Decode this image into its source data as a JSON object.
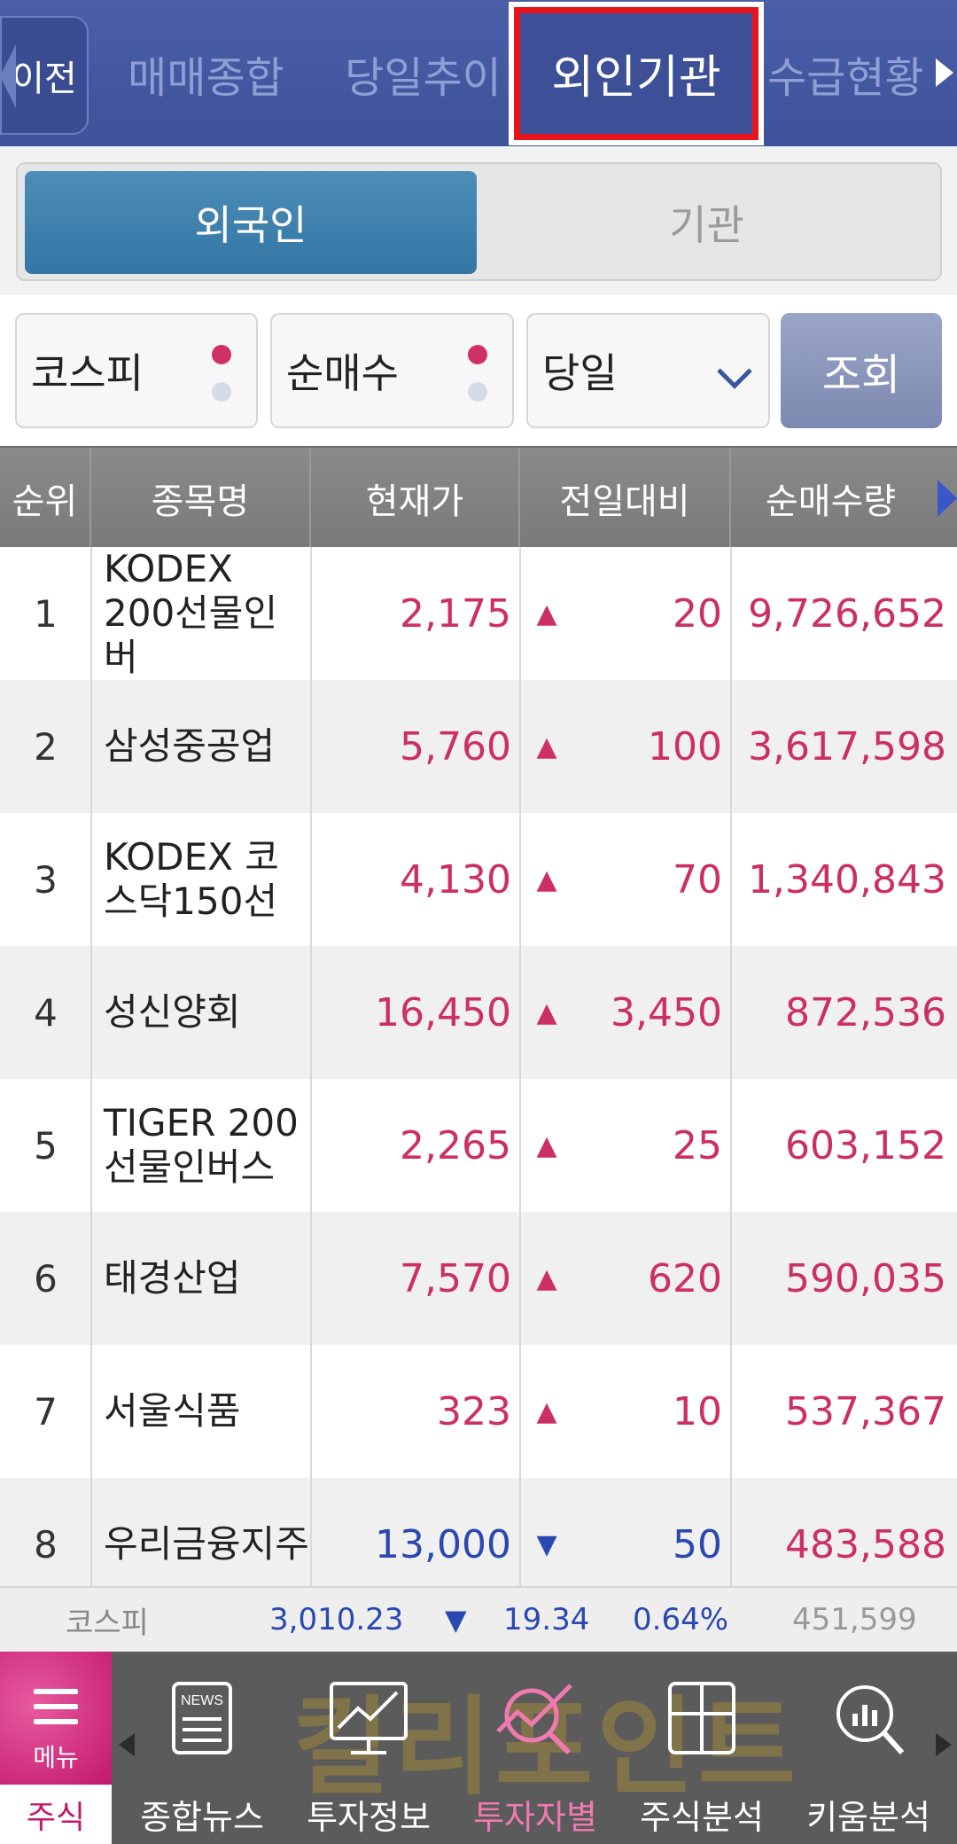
{
  "top_tabs": {
    "back": "이전",
    "items": [
      "매매종합",
      "당일추이",
      "외인기관",
      "수급현황"
    ],
    "active": "외인기관"
  },
  "segment": {
    "foreign": "외국인",
    "institution": "기관",
    "active": "외국인"
  },
  "filters": {
    "market": "코스피",
    "type": "순매수",
    "period": "당일",
    "query": "조회"
  },
  "table": {
    "headers": [
      "순위",
      "종목명",
      "현재가",
      "전일대비",
      "순매수량"
    ],
    "rows": [
      {
        "rank": "1",
        "name": "KODEX 200선물인버",
        "price": "2,175",
        "dir": "▲",
        "change": "20",
        "volume": "9,726,652"
      },
      {
        "rank": "2",
        "name": "삼성중공업",
        "price": "5,760",
        "dir": "▲",
        "change": "100",
        "volume": "3,617,598"
      },
      {
        "rank": "3",
        "name": "KODEX 코스닥150선",
        "price": "4,130",
        "dir": "▲",
        "change": "70",
        "volume": "1,340,843"
      },
      {
        "rank": "4",
        "name": "성신양회",
        "price": "16,450",
        "dir": "▲",
        "change": "3,450",
        "volume": "872,536"
      },
      {
        "rank": "5",
        "name": "TIGER 200선물인버스",
        "price": "2,265",
        "dir": "▲",
        "change": "25",
        "volume": "603,152"
      },
      {
        "rank": "6",
        "name": "태경산업",
        "price": "7,570",
        "dir": "▲",
        "change": "620",
        "volume": "590,035"
      },
      {
        "rank": "7",
        "name": "서울식품",
        "price": "323",
        "dir": "▲",
        "change": "10",
        "volume": "537,367"
      },
      {
        "rank": "8",
        "name": "우리금융지주",
        "price": "13,000",
        "dir": "▼",
        "change": "50",
        "volume": "483,588"
      }
    ]
  },
  "index_strip": {
    "name": "코스피",
    "value": "3,010.23",
    "dir": "▼",
    "change": "19.34",
    "pct": "0.64%",
    "volume": "451,599"
  },
  "bottom_nav": {
    "menu": "메뉴",
    "stock": "주식",
    "items": [
      "종합뉴스",
      "투자정보",
      "투자자별",
      "주식분석",
      "키움분석"
    ],
    "active": "투자자별",
    "news_badge": "NEWS",
    "watermark": "킬리포인트"
  },
  "colors": {
    "up": "#cc2f62",
    "down": "#2a48b0",
    "header_bg": "#3d5299",
    "highlight": "#e8141c",
    "accent": "#c2186b"
  }
}
